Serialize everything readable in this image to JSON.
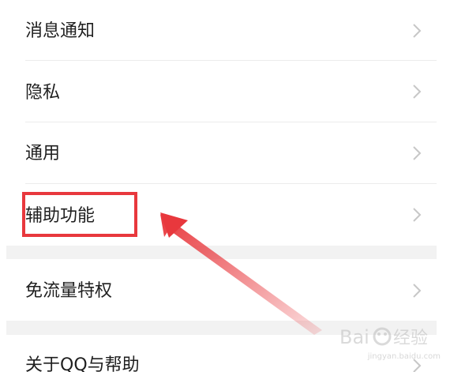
{
  "settings": {
    "items": [
      {
        "label": "消息通知"
      },
      {
        "label": "隐私"
      },
      {
        "label": "通用"
      },
      {
        "label": "辅助功能"
      },
      {
        "label": "免流量特权"
      },
      {
        "label": "关于QQ与帮助"
      }
    ]
  },
  "watermark": {
    "text": "jingyan.baidu.com"
  },
  "icons": {
    "chevron": "chevron-right-icon",
    "arrow": "red-arrow-annotation",
    "highlight": "red-highlight-box"
  },
  "colors": {
    "highlight": "#e8383d",
    "text": "#1f1f1f",
    "chevron": "#c7c7c7",
    "divider": "#ececec",
    "section_gap": "#f2f2f2"
  }
}
